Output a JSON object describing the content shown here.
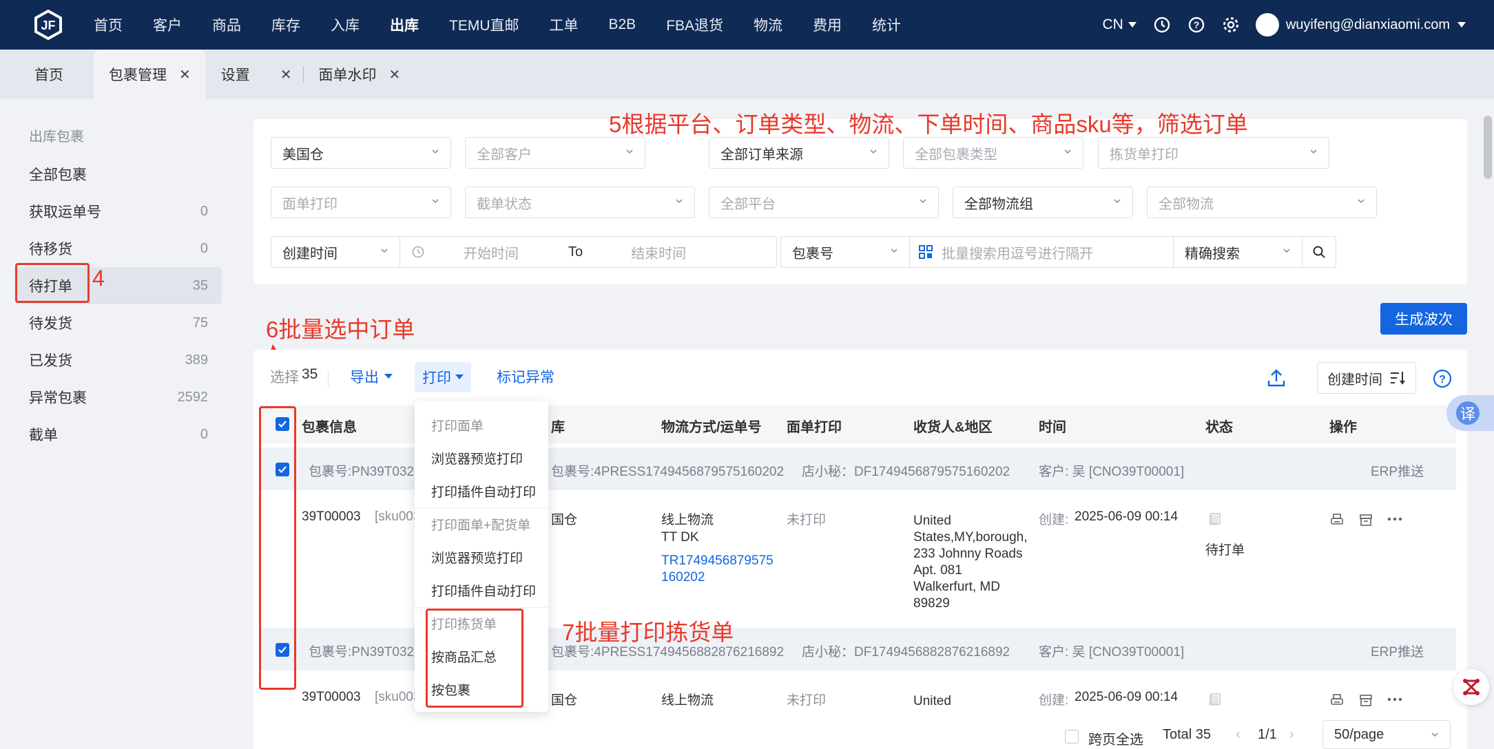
{
  "topnav": {
    "items": [
      "首页",
      "客户",
      "商品",
      "库存",
      "入库",
      "出库",
      "TEMU直邮",
      "工单",
      "B2B",
      "FBA退货",
      "物流",
      "费用",
      "统计"
    ],
    "active": "出库",
    "lang": "CN",
    "user": "wuyifeng@dianxiaomi.com"
  },
  "tabs": [
    {
      "label": "首页"
    },
    {
      "label": "包裹管理",
      "close": "✕"
    },
    {
      "label": "设置",
      "close": "✕"
    },
    {
      "label": "面单水印",
      "close": "✕"
    }
  ],
  "sidebar": {
    "title": "出库包裹",
    "items": [
      {
        "label": "全部包裹",
        "count": ""
      },
      {
        "label": "获取运单号",
        "count": "0"
      },
      {
        "label": "待移货",
        "count": "0"
      },
      {
        "label": "待打单",
        "count": "35"
      },
      {
        "label": "待发货",
        "count": "75"
      },
      {
        "label": "已发货",
        "count": "389"
      },
      {
        "label": "异常包裹",
        "count": "2592"
      },
      {
        "label": "截单",
        "count": "0"
      }
    ]
  },
  "filters": {
    "row1": [
      "美国仓",
      "全部客户",
      "全部订单来源",
      "全部包裹类型",
      "拣货单打印"
    ],
    "row2": [
      "面单打印",
      "截单状态",
      "全部平台",
      "全部物流组",
      "全部物流"
    ],
    "time_type": "创建时间",
    "start_placeholder": "开始时间",
    "to": "To",
    "end_placeholder": "结束时间",
    "search_type": "包裹号",
    "search_placeholder": "批量搜索用逗号进行隔开",
    "search_mode": "精确搜索"
  },
  "annotations": {
    "a4": "4",
    "a5": "5根据平台、订单类型、物流、下单时间、商品sku等，筛选订单",
    "a6": "6批量选中订单",
    "a7": "7批量打印拣货单"
  },
  "generate_button": "生成波次",
  "toolbar": {
    "select_label": "选择",
    "select_count": "35",
    "export": "导出",
    "print": "打印",
    "mark_abnormal": "标记异常",
    "sort": "创建时间"
  },
  "table": {
    "headers": [
      "包裹信息",
      "库",
      "物流方式/运单号",
      "面单打印",
      "收货人&地区",
      "时间",
      "状态",
      "操作"
    ],
    "rows": [
      {
        "pkg_no": "包裹号:PN39T0328",
        "pkg_no2": "包裹号:4PRESS1749456879575160202",
        "shop": "店小秘：DF1749456879575160202",
        "customer": "客户: 吴 [CNO39T00001]",
        "erp": "ERP推送",
        "sku": "39T00003",
        "sku_code": "[sku003]",
        "warehouse": "国仓",
        "logistics": "线上物流",
        "carrier": "TT DK",
        "tracking": "TR1749456879575",
        "tracking2": "160202",
        "label_print": "未打印",
        "address": [
          "United",
          "States,MY,borough,",
          "233 Johnny Roads",
          "Apt. 081",
          "Walkerfurt, MD",
          "89829"
        ],
        "time_label": "创建:",
        "time": "2025-06-09 00:14",
        "status": "待打单"
      },
      {
        "pkg_no": "包裹号:PN39T0328",
        "pkg_no2": "包裹号:4PRESS1749456882876216892",
        "shop": "店小秘：DF1749456882876216892",
        "customer": "客户: 吴 [CNO39T00001]",
        "erp": "ERP推送",
        "sku": "39T00003",
        "sku_code": "[sku003]",
        "warehouse": "国仓",
        "logistics": "线上物流",
        "label_print": "未打印",
        "address1": "United",
        "time_label": "创建:",
        "time": "2025-06-09 00:14"
      }
    ]
  },
  "print_menu": {
    "h1": "打印面单",
    "i1": "浏览器预览打印",
    "i2": "打印插件自动打印",
    "h2": "打印面单+配货单",
    "i3": "浏览器预览打印",
    "i4": "打印插件自动打印",
    "h3": "打印拣货单",
    "i5": "按商品汇总",
    "i6": "按包裹"
  },
  "footer": {
    "cross_page": "跨页全选",
    "total": "Total 35",
    "page": "1/1",
    "page_size": "50/page"
  },
  "translate_label": "译",
  "colors": {
    "nav_bg": "#0f2a54",
    "primary": "#1366e0",
    "annotation": "#e8392b"
  }
}
